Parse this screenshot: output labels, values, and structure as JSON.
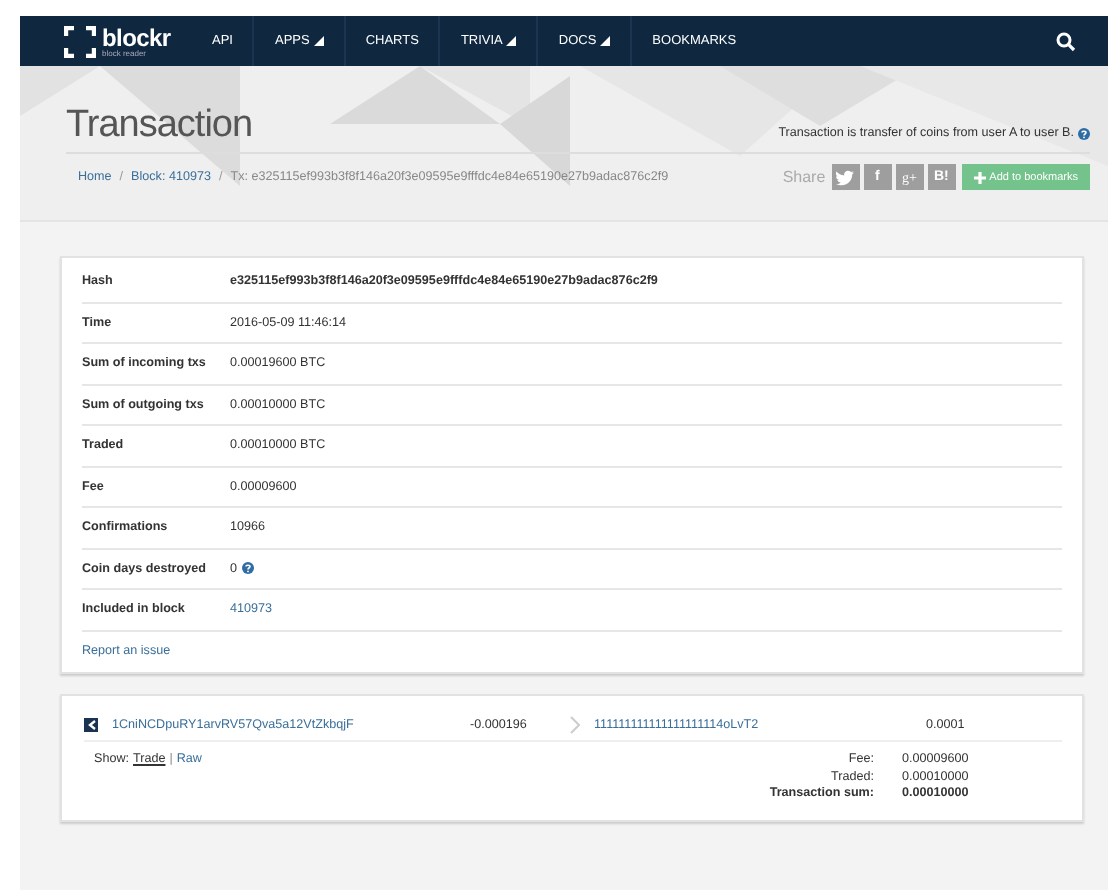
{
  "nav": {
    "logo": "blockr",
    "logo_sub": "block reader",
    "items": [
      {
        "label": "API",
        "dropdown": false
      },
      {
        "label": "APPS",
        "dropdown": true
      },
      {
        "label": "CHARTS",
        "dropdown": false
      },
      {
        "label": "TRIVIA",
        "dropdown": true
      },
      {
        "label": "DOCS",
        "dropdown": true
      },
      {
        "label": "BOOKMARKS",
        "dropdown": false
      }
    ]
  },
  "header": {
    "title": "Transaction",
    "description": "Transaction is transfer of coins from user A to user B.",
    "breadcrumb": [
      {
        "label": "Home",
        "link": true
      },
      {
        "label": "Block: 410973",
        "link": true
      },
      {
        "label": "Tx: e325115ef993b3f8f146a20f3e09595e9fffdc4e84e65190e27b9adac876c2f9",
        "link": false
      }
    ],
    "breadcrumb_separator": "/",
    "share_label": "Share",
    "share_buttons": [
      {
        "kind": "twitter"
      },
      {
        "kind": "facebook",
        "label": "f"
      },
      {
        "kind": "google",
        "label": "g+"
      },
      {
        "kind": "blogger",
        "label": "B!"
      }
    ],
    "bookmark_button": "Add to bookmarks"
  },
  "details": {
    "rows": [
      {
        "label": "Hash",
        "value": "e325115ef993b3f8f146a20f3e09595e9fffdc4e84e65190e27b9adac876c2f9",
        "kind": "bold"
      },
      {
        "label": "Time",
        "value": "2016-05-09 11:46:14",
        "kind": "text"
      },
      {
        "label": "Sum of incoming txs",
        "value": "0.00019600 BTC",
        "kind": "text"
      },
      {
        "label": "Sum of outgoing txs",
        "value": "0.00010000 BTC",
        "kind": "text"
      },
      {
        "label": "Traded",
        "value": "0.00010000 BTC",
        "kind": "text"
      },
      {
        "label": "Fee",
        "value": "0.00009600",
        "kind": "text"
      },
      {
        "label": "Confirmations",
        "value": "10966",
        "kind": "text"
      },
      {
        "label": "Coin days destroyed",
        "value": "0",
        "kind": "help"
      },
      {
        "label": "Included in block",
        "value": "410973",
        "kind": "link"
      }
    ],
    "report_link": "Report an issue"
  },
  "io": {
    "input_address": "1CniNCDpuRY1arvRV57Qva5a12VtZkbqjF",
    "input_amount": "-0.000196",
    "output_address": "111111111111111111114oLvT2",
    "output_amount": "0.0001",
    "show_label": "Show:",
    "view_separator": "|",
    "views": [
      {
        "label": "Trade",
        "selected": true
      },
      {
        "label": "Raw",
        "selected": false
      }
    ],
    "summary": [
      {
        "label": "Fee:",
        "value": "0.00009600",
        "bold": false
      },
      {
        "label": "Traded:",
        "value": "0.00010000",
        "bold": false
      },
      {
        "label": "Transaction sum:",
        "value": "0.00010000",
        "bold": true
      }
    ]
  }
}
